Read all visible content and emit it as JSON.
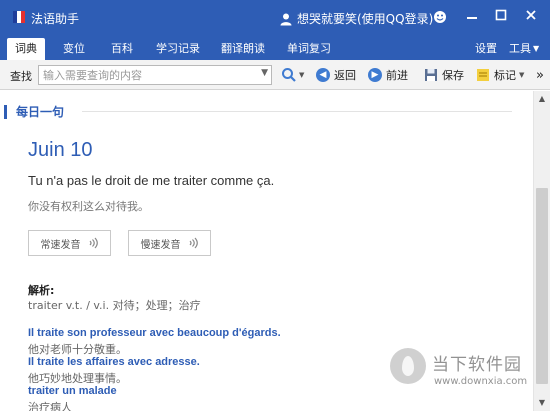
{
  "window": {
    "title": "法语助手",
    "user_label": "想哭就要笑(使用QQ登录)",
    "titlebar_color": "#2e5db5",
    "logo_colors": [
      "#1f3d9a",
      "#ffffff",
      "#e53030"
    ]
  },
  "tabs": [
    {
      "label": "词典",
      "active": true
    },
    {
      "label": "变位"
    },
    {
      "label": "百科"
    },
    {
      "label": "学习记录"
    },
    {
      "label": "翻译朗读"
    },
    {
      "label": "单词复习"
    }
  ],
  "tab_right": {
    "settings": "设置",
    "tools": "工具"
  },
  "toolbar": {
    "search_label": "查找",
    "search_placeholder": "输入需要查询的内容",
    "back": "返回",
    "forward": "前进",
    "save": "保存",
    "bookmark": "标记"
  },
  "daily": {
    "section_title": "每日一句",
    "date": "Juin 10",
    "sentence_fr": "Tu n'a pas le droit de me traiter comme ça.",
    "sentence_zh": "你没有权利这么对待我。",
    "normal_speed": "常速发音",
    "slow_speed": "慢速发音",
    "analysis_label": "解析:",
    "analysis_text": "traiter v.t. / v.i. 对待；处理；治疗",
    "examples": [
      {
        "fr": "Il traite son professeur avec beaucoup d'égards.",
        "zh": "他对老师十分敬重。"
      },
      {
        "fr": "Il traite les affaires avec adresse.",
        "zh": "他巧妙地处理事情。"
      },
      {
        "fr": "traiter un malade",
        "zh": "治疗病人"
      }
    ]
  },
  "watermark": {
    "brand": "当下软件园",
    "url": "www.downxia.com"
  }
}
